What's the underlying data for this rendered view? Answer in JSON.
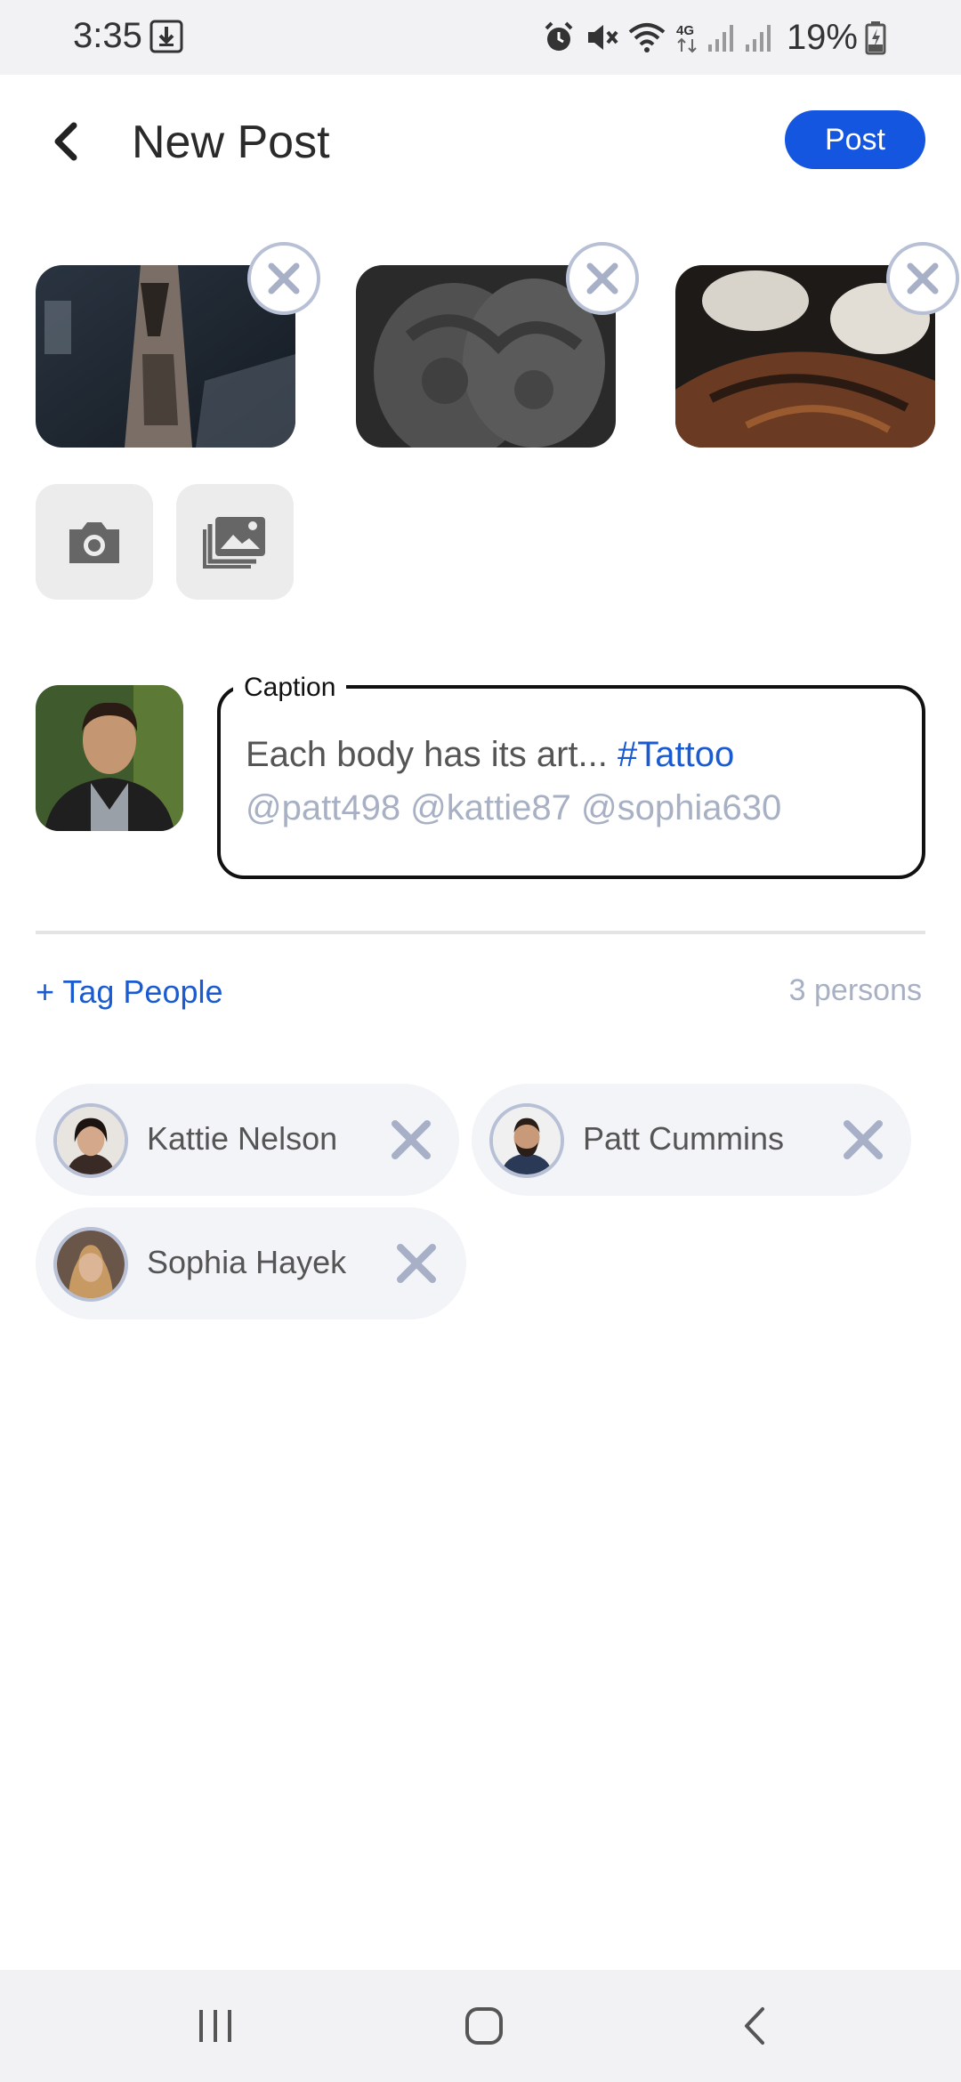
{
  "status_bar": {
    "time": "3:35",
    "battery": "19%",
    "icons": [
      "download-icon",
      "alarm-icon",
      "mute-icon",
      "wifi-icon",
      "4g-icon",
      "signal-icon",
      "signal-icon",
      "battery-charging-icon"
    ]
  },
  "header": {
    "title": "New Post",
    "post_label": "Post",
    "back_icon": "chevron-left-icon"
  },
  "media": {
    "thumbnails": [
      {
        "description_icon": "photo-thumbnail"
      },
      {
        "description_icon": "photo-thumbnail"
      },
      {
        "description_icon": "photo-thumbnail"
      }
    ],
    "camera_icon": "camera-icon",
    "gallery_icon": "gallery-icon"
  },
  "caption": {
    "label": "Caption",
    "text": "Each body has its art...",
    "hashtag": "#Tattoo",
    "mentions": "@patt498 @kattie87 @sophia630"
  },
  "tags": {
    "add_label": "+ Tag People",
    "count_label": "3 persons",
    "people": [
      {
        "name": "Kattie Nelson"
      },
      {
        "name": "Patt Cummins"
      },
      {
        "name": "Sophia Hayek"
      }
    ]
  },
  "colors": {
    "accent": "#1456e0",
    "link": "#1a5bd1",
    "muted": "#a8b0c4",
    "chip_bg": "#f3f4f7"
  }
}
